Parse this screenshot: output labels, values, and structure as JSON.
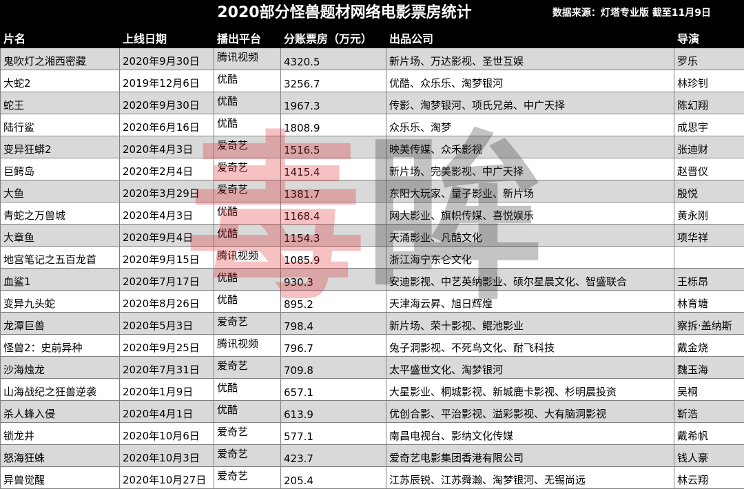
{
  "title": "2020部分怪兽题材网络电影票房统计",
  "source_note": "数据来源：灯塔专业版  截至11月9日",
  "watermark": [
    "毒",
    "眸"
  ],
  "headers": [
    "片名",
    "上线日期",
    "播出平台",
    "分账票房（万元）",
    "出品公司",
    "导演"
  ],
  "rows": [
    [
      "鬼吹灯之湘西密藏",
      "2020年9月30日",
      "腾讯视频",
      "4320.5",
      "新片场、万达影视、圣世互娱",
      "罗乐"
    ],
    [
      "大蛇2",
      "2019年12月6日",
      "优酷",
      "3256.7",
      "优酷、众乐乐、淘梦银河",
      "林珍钊"
    ],
    [
      "蛇王",
      "2020年9月30日",
      "优酷",
      "1967.3",
      "传影、淘梦银河、项氏兄弟、中广天择",
      "陈幻翔"
    ],
    [
      "陆行鲨",
      "2020年6月16日",
      "优酷",
      "1808.9",
      "众乐乐、淘梦",
      "成思宇"
    ],
    [
      "变异狂蟒2",
      "2020年4月3日",
      "爱奇艺",
      "1516.5",
      "映美传媒、众禾影视",
      "张迪财"
    ],
    [
      "巨鳄岛",
      "2020年2月4日",
      "爱奇艺",
      "1415.4",
      "新片场、完美影视、中广天择",
      "赵晋仪"
    ],
    [
      "大鱼",
      "2020年3月29日",
      "爱奇艺",
      "1381.7",
      "东阳大玩家、量子影业、新片场",
      "殷悦"
    ],
    [
      "青蛇之万兽城",
      "2020年4月3日",
      "优酷",
      "1168.4",
      "网大影业、旗帜传媒、喜悦娱乐",
      "黄永刚"
    ],
    [
      "大章鱼",
      "2020年9月4日",
      "优酷",
      "1154.3",
      "天涌影业、凡酷文化",
      "项华祥"
    ],
    [
      "地宫笔记之五百龙首",
      "2020年9月15日",
      "腾讯视频",
      "1085.9",
      "浙江海宁东仑文化",
      ""
    ],
    [
      "血鲨1",
      "2020年7月17日",
      "优酷",
      "930.3",
      "安迪影视、中艺英纳影业、硕尔星晨文化、智盛联合",
      "王栎昂"
    ],
    [
      "变异九头蛇",
      "2020年8月26日",
      "优酷",
      "895.2",
      "天津海云昇、旭日辉煌",
      "林育塘"
    ],
    [
      "龙潭巨兽",
      "2020年5月3日",
      "爱奇艺",
      "798.4",
      "新片场、荣十影视、鲲池影业",
      "察拆·盖纳斯"
    ],
    [
      "怪兽2：史前异种",
      "2020年9月25日",
      "腾讯视频",
      "796.7",
      "兔子洞影视、不死鸟文化、耐飞科技",
      "戴金烧"
    ],
    [
      "沙海烛龙",
      "2020年7月31日",
      "爱奇艺",
      "709.8",
      "太平盛世文化、淘梦银河",
      "魏玉海"
    ],
    [
      "山海战纪之狂兽逆袭",
      "2020年1月9日",
      "优酷",
      "657.1",
      "大星影业、桐城影视、新城鹿卡影视、杉明晨投资",
      "吴桐"
    ],
    [
      "杀人蜂入侵",
      "2020年4月1日",
      "优酷",
      "613.9",
      "优创合影、平治影视、溢彩影视、大有脑洞影视",
      "靳浩"
    ],
    [
      "锁龙井",
      "2020年10月6日",
      "爱奇艺",
      "577.1",
      "南昌电视台、影纳文化传媒",
      "戴希帆"
    ],
    [
      "怒海狂蛛",
      "2020年10月3日",
      "爱奇艺",
      "423.7",
      "爱奇艺电影集团香港有限公司",
      "钱人豪"
    ],
    [
      "异兽觉醒",
      "2020年10月27日",
      "爱奇艺",
      "205.4",
      "江苏辰锐、江苏舜瀚、淘梦银河、无锡尚远",
      "林云翔"
    ]
  ]
}
